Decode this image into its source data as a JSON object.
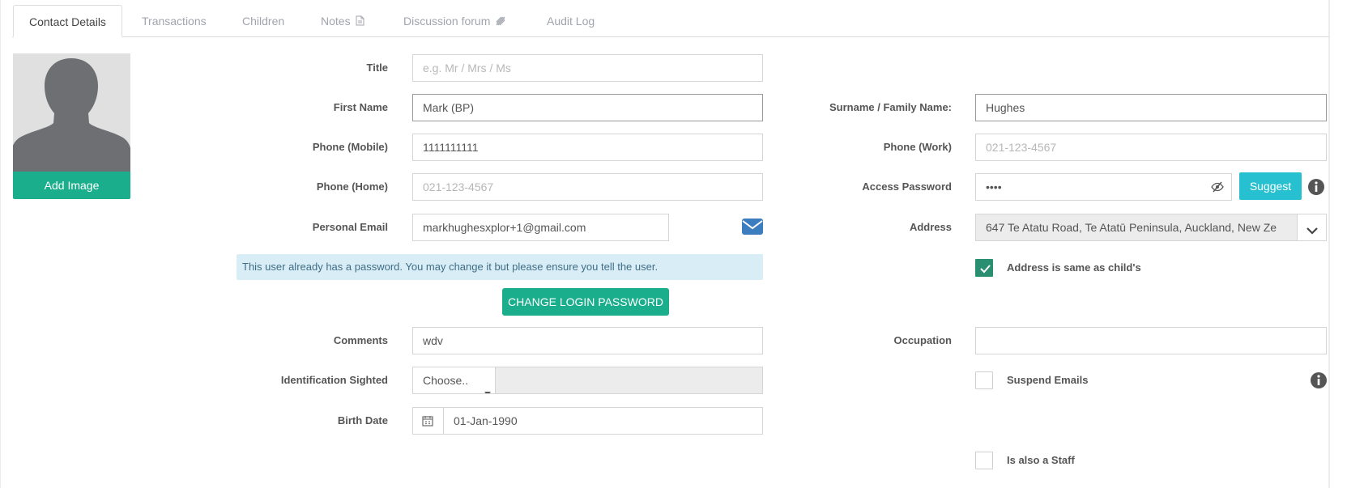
{
  "tabs": [
    {
      "label": "Contact Details"
    },
    {
      "label": "Transactions"
    },
    {
      "label": "Children"
    },
    {
      "label": "Notes"
    },
    {
      "label": "Discussion forum"
    },
    {
      "label": "Audit Log"
    }
  ],
  "avatar": {
    "add_image_label": "Add Image"
  },
  "form": {
    "title": {
      "label": "Title",
      "placeholder": "e.g. Mr / Mrs / Ms",
      "value": ""
    },
    "first_name": {
      "label": "First Name",
      "value": "Mark (BP)"
    },
    "surname": {
      "label": "Surname / Family Name:",
      "value": "Hughes"
    },
    "phone_mobile": {
      "label": "Phone (Mobile)",
      "value": "1111111111"
    },
    "phone_work": {
      "label": "Phone (Work)",
      "placeholder": "021-123-4567",
      "value": ""
    },
    "phone_home": {
      "label": "Phone (Home)",
      "placeholder": "021-123-4567",
      "value": ""
    },
    "access_password": {
      "label": "Access Password",
      "value": "••••",
      "suggest_label": "Suggest"
    },
    "personal_email": {
      "label": "Personal Email",
      "value": "markhughesxplor+1@gmail.com"
    },
    "address": {
      "label": "Address",
      "value": "647 Te Atatu Road, Te Atatū Peninsula, Auckland, New Ze"
    },
    "address_same": {
      "label": "Address is same as child's",
      "checked": true
    },
    "password_notice": "This user already has a password. You may change it but please ensure you tell the user.",
    "change_password_label": "CHANGE LOGIN PASSWORD",
    "comments": {
      "label": "Comments",
      "value": "wdv"
    },
    "occupation": {
      "label": "Occupation",
      "value": ""
    },
    "identification": {
      "label": "Identification Sighted",
      "selected": "Choose..",
      "detail": ""
    },
    "suspend_emails": {
      "label": "Suspend Emails",
      "checked": false
    },
    "birth_date": {
      "label": "Birth Date",
      "value": "01-Jan-1990"
    },
    "is_staff": {
      "label": "Is also a Staff",
      "checked": false
    }
  },
  "colors": {
    "primary": "#1aae8c",
    "suggest": "#27c0d0",
    "info_bg": "#d9edf7",
    "checkbox_on": "#2a8e71",
    "email_icon": "#3b7dbf"
  },
  "icons": [
    "person-silhouette",
    "notes-file-icon",
    "forum-icon",
    "envelope-icon",
    "eye-slash-icon",
    "info-icon",
    "chevron-down-icon",
    "calendar-icon",
    "caret-down-icon",
    "check-icon"
  ]
}
